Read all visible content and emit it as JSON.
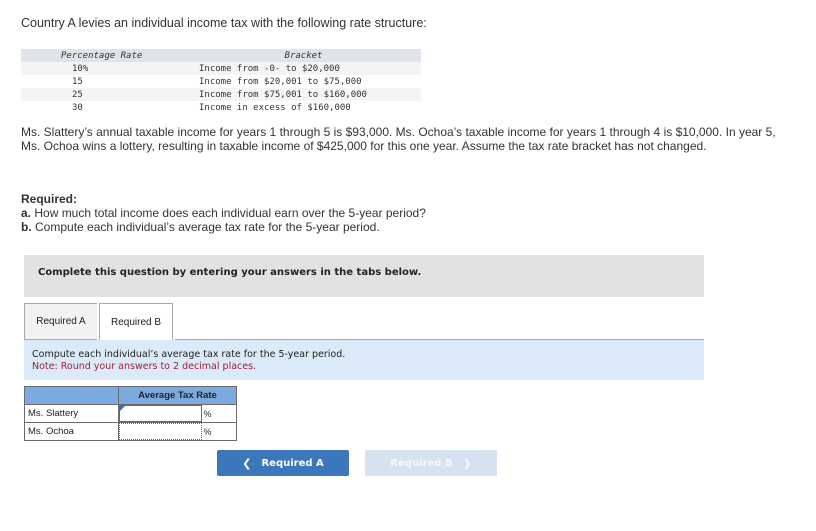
{
  "intro": "Country A levies an individual income tax with the following rate structure:",
  "rate_table": {
    "headers": [
      "Percentage Rate",
      "Bracket"
    ],
    "rows": [
      {
        "rate": "10%",
        "bracket": "Income from -0- to $20,000"
      },
      {
        "rate": "15",
        "bracket": "Income from $20,001 to $75,000"
      },
      {
        "rate": "25",
        "bracket": "Income from $75,001 to $160,000"
      },
      {
        "rate": "30",
        "bracket": "Income in excess of $160,000"
      }
    ]
  },
  "problem_text": "Ms. Slattery’s annual taxable income for years 1 through 5 is $93,000. Ms. Ochoa’s taxable income for years 1 through 4 is $10,000. In year 5, Ms. Ochoa wins a lottery, resulting in taxable income of $425,000 for this one year. Assume the tax rate bracket has not changed.",
  "required": {
    "header": "Required:",
    "a_label": "a.",
    "a_text": " How much total income does each individual earn over the 5-year period?",
    "b_label": "b.",
    "b_text": " Compute each individual’s average tax rate for the 5-year period."
  },
  "banner": "Complete this question by entering your answers in the tabs below.",
  "tabs": [
    {
      "label": "Required A",
      "active": false
    },
    {
      "label": "Required B",
      "active": true
    }
  ],
  "instructions": {
    "text": "Compute each individual’s average tax rate for the 5-year period.",
    "note": "Note: Round your answers to 2 decimal places."
  },
  "answer_table": {
    "header": "Average Tax Rate",
    "rows": [
      {
        "name": "Ms. Slattery",
        "value": "",
        "unit": "%"
      },
      {
        "name": "Ms. Ochoa",
        "value": "",
        "unit": "%"
      }
    ]
  },
  "nav": {
    "prev_label": "Required A",
    "prev_icon": "chevron-left-icon",
    "next_label": "Required B",
    "next_icon": "chevron-right-icon"
  }
}
